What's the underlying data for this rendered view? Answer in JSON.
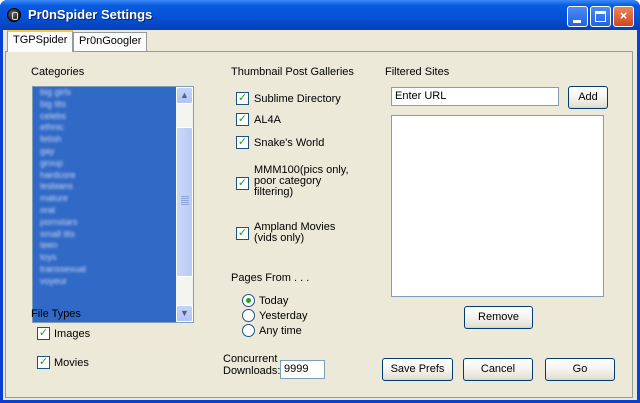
{
  "window": {
    "title": "Pr0nSpider Settings",
    "buttons": {
      "minimize": "minimize",
      "maximize": "maximize",
      "close": "×"
    }
  },
  "tabs": [
    {
      "label": "TGPSpider",
      "active": true
    },
    {
      "label": "Pr0nGoogler",
      "active": false
    }
  ],
  "categories": {
    "label": "Categories",
    "items": [
      "big girls",
      "big tits",
      "celebs",
      "ethnic",
      "fetish",
      "gay",
      "group",
      "hardcore",
      "lesbians",
      "mature",
      "oral",
      "pornstars",
      "small tits",
      "teen",
      "toys",
      "transsexual",
      "voyeur"
    ]
  },
  "file_types": {
    "label": "File Types",
    "options": [
      {
        "label": "Images",
        "checked": true
      },
      {
        "label": "Movies",
        "checked": true
      }
    ]
  },
  "galleries": {
    "label": "Thumbnail Post Galleries",
    "options": [
      {
        "label": "Sublime Directory",
        "checked": true
      },
      {
        "label": "AL4A",
        "checked": true
      },
      {
        "label": "Snake's World",
        "checked": true
      },
      {
        "label": "MMM100(pics only, poor category filtering)",
        "checked": true
      },
      {
        "label": "Ampland Movies (vids only)",
        "checked": true
      }
    ]
  },
  "pages_from": {
    "label": "Pages From . . .",
    "options": [
      {
        "label": "Today",
        "selected": true
      },
      {
        "label": "Yesterday",
        "selected": false
      },
      {
        "label": "Any time",
        "selected": false
      }
    ]
  },
  "concurrent": {
    "label": "Concurrent Downloads:",
    "value": "9999"
  },
  "filtered_sites": {
    "label": "Filtered Sites",
    "url_value": "Enter URL",
    "add_label": "Add",
    "remove_label": "Remove"
  },
  "footer": {
    "save_label": "Save Prefs",
    "cancel_label": "Cancel",
    "go_label": "Go"
  },
  "colors": {
    "selection": "#3169c6",
    "title_bar": "#0552d6",
    "panel": "#ece9d8",
    "check": "#21a121"
  }
}
